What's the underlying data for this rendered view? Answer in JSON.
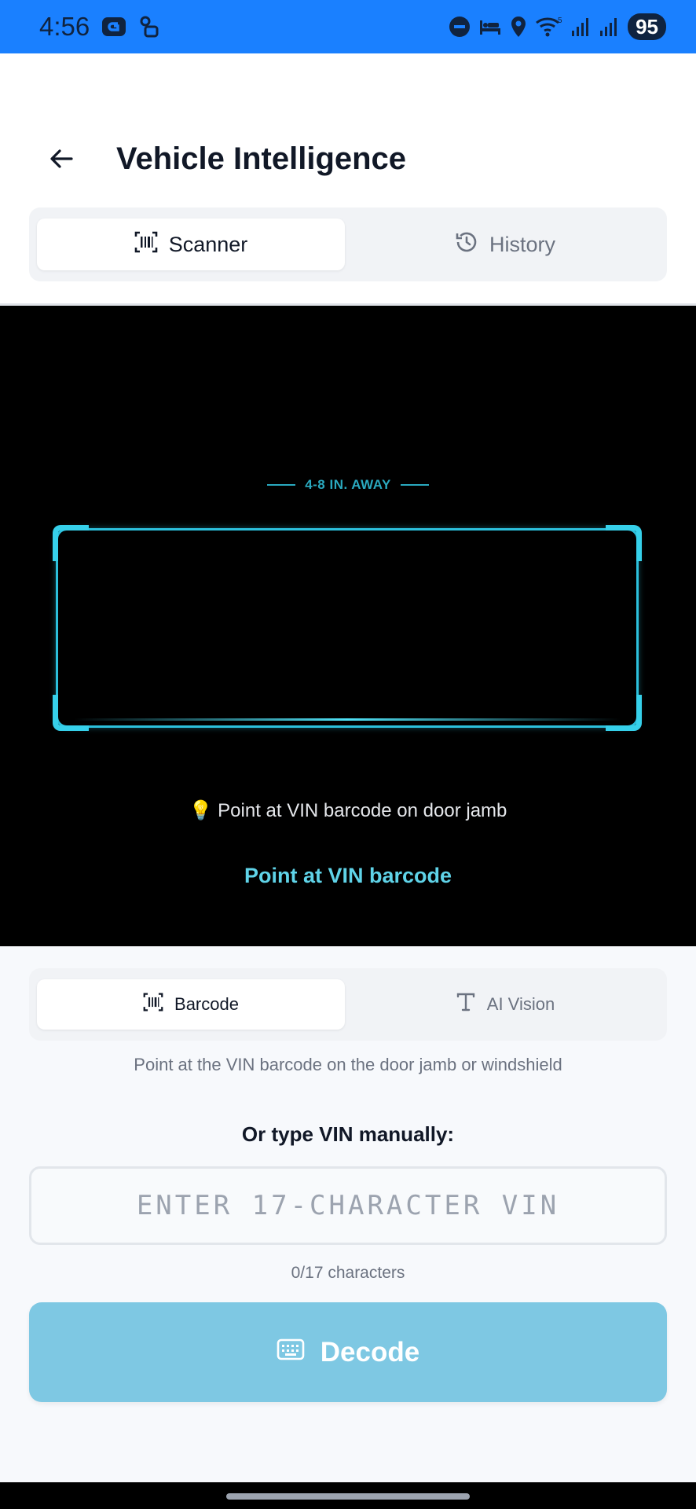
{
  "status_bar": {
    "time": "4:56",
    "battery": "95",
    "wifi_badge": "5"
  },
  "header": {
    "title": "Vehicle Intelligence"
  },
  "tabs": [
    {
      "label": "Scanner",
      "icon": "barcode-scan-icon",
      "active": true
    },
    {
      "label": "History",
      "icon": "history-icon",
      "active": false
    }
  ],
  "camera": {
    "distance_label": "4-8 IN. AWAY",
    "tip": "💡 Point at VIN barcode on door jamb",
    "status": "Point at VIN barcode",
    "frame_color": "#2cc0dc"
  },
  "modes": [
    {
      "label": "Barcode",
      "icon": "barcode-icon",
      "active": true
    },
    {
      "label": "AI Vision",
      "icon": "text-icon",
      "active": false
    }
  ],
  "hint": "Point at the VIN barcode on the door jamb or windshield",
  "manual": {
    "label": "Or type VIN manually:",
    "placeholder": "ENTER 17-CHARACTER VIN",
    "value": "",
    "counter": "0/17 characters"
  },
  "decode_button": {
    "label": "Decode",
    "icon": "keyboard-icon",
    "color": "#7ec8e3"
  },
  "colors": {
    "status_bar": "#1a80ff",
    "accent": "#2cc0dc"
  }
}
